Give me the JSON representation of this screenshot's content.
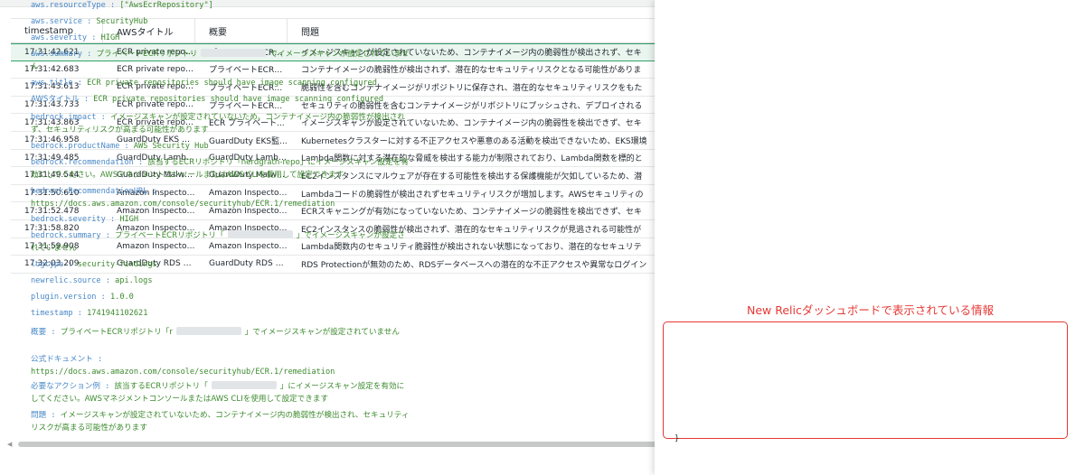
{
  "table": {
    "headers": [
      "timestamp",
      "AWSタイトル",
      "概要",
      "問題"
    ],
    "rows": [
      {
        "timestamp": "17:31:42.621",
        "title": "ECR private reposit...",
        "summary": "プライベートECRリ...",
        "problem": "イメージスキャンが設定されていないため、コンテナイメージ内の脆弱性が検出されず、セキ"
      },
      {
        "timestamp": "17:31:42.683",
        "title": "ECR private reposit...",
        "summary": "プライベートECRリ...",
        "problem": "コンテナイメージの脆弱性が検出されず、潜在的なセキュリティリスクとなる可能性がありま"
      },
      {
        "timestamp": "17:31:43.613",
        "title": "ECR private reposit...",
        "summary": "プライベートECRリ...",
        "problem": "脆弱性を含むコンテナイメージがリポジトリに保存され、潜在的なセキュリティリスクをもた"
      },
      {
        "timestamp": "17:31:43.733",
        "title": "ECR private reposit...",
        "summary": "プライベートECRリ...",
        "problem": "セキュリティの脆弱性を含むコンテナイメージがリポジトリにプッシュされ、デプロイされる"
      },
      {
        "timestamp": "17:31:43.863",
        "title": "ECR private reposit...",
        "summary": "ECR プライベート...",
        "problem": "イメージスキャンが設定されていないため、コンテナイメージ内の脆弱性を検出できず、セキ"
      },
      {
        "timestamp": "17:31:46.958",
        "title": "GuardDuty EKS Au...",
        "summary": "GuardDuty EKS監...",
        "problem": "Kubernetesクラスターに対する不正アクセスや悪意のある活動を検出できないため、EKS環境"
      },
      {
        "timestamp": "17:31:49.485",
        "title": "GuardDuty Lambda...",
        "summary": "GuardDuty Lambda...",
        "problem": "Lambda関数に対する潜在的な脅威を検出する能力が制限されており、Lambda関数を標的と"
      },
      {
        "timestamp": "17:31:49.544",
        "title": "GuardDuty Malwar...",
        "summary": "GuardDuty Malwar...",
        "problem": "EC2インスタンスにマルウェアが存在する可能性を検出する保護機能が欠如しているため、潜"
      },
      {
        "timestamp": "17:31:50.610",
        "title": "Amazon Inspector ...",
        "summary": "Amazon Inspector ...",
        "problem": "Lambdaコードの脆弱性が検出されずセキュリティリスクが増加します。AWSセキュリティの"
      },
      {
        "timestamp": "17:31:52.478",
        "title": "Amazon Inspector ...",
        "summary": "Amazon Inspector ...",
        "problem": "ECRスキャニングが有効になっていないため、コンテナイメージの脆弱性を検出できず、セキ"
      },
      {
        "timestamp": "17:31:58.820",
        "title": "Amazon Inspector ...",
        "summary": "Amazon Inspector ...",
        "problem": "EC2インスタンスの脆弱性が検出されず、潜在的なセキュリティリスクが見逃される可能性が"
      },
      {
        "timestamp": "17:31:59.908",
        "title": "Amazon Inspector ...",
        "summary": "Amazon Inspector ...",
        "problem": "Lambda関数内のセキュリティ脆弱性が検出されない状態になっており、潜在的なセキュリテ"
      },
      {
        "timestamp": "17:32:03.209",
        "title": "GuardDuty RDS Pr...",
        "summary": "GuardDuty RDS Pr...",
        "problem": "RDS Protectionが無効のため、RDSデータベースへの潜在的な不正アクセスや異常なログイン"
      }
    ]
  },
  "detail": {
    "sep": " : ",
    "resource_type": {
      "key": "aws.resourceType",
      "value": "[\"AwsEcrRepository\"]"
    },
    "service": {
      "key": "aws.service",
      "value": "SecurityHub"
    },
    "severity": {
      "key": "aws.severity",
      "value": "HIGH"
    },
    "summary": {
      "key": "aws.summary",
      "value_a": "プライベートECRリポジトリ",
      "value_b": "でイメージスキャンが設定されていません"
    },
    "title": {
      "key": "aws.title",
      "value": "ECR private repositories should have image scanning configured"
    },
    "aws_title_jp": {
      "key": "AWSタイトル",
      "value": "ECR private repositories should have image scanning configured"
    },
    "impact": {
      "key": "bedrock.impact",
      "value": "イメージスキャンが設定されていないため、コンテナイメージ内の脆弱性が検出されず、セキュリティリスクが高まる可能性があります"
    },
    "product_name": {
      "key": "bedrock.productName",
      "value": "AWS Security Hub"
    },
    "recommendation": {
      "key": "bedrock.recommendation",
      "value": "該当するECRリポジトリ「nerdgrath-repo」にイメージスキャン設定を有効にしてください。AWSマネジメントコンソールまたはAWS CLIを使用して設定できます"
    },
    "recommendation_url": {
      "key": "bedrock.RecommendationURL",
      "value": "https://docs.aws.amazon.com/console/securityhub/ECR.1/remediation"
    },
    "b_severity": {
      "key": "bedrock.severity",
      "value": "HIGH"
    },
    "b_summary": {
      "key": "bedrock.summary",
      "value_a": "プライベートECRリポジトリ「",
      "value_b": "」でイメージスキャンが設定されていません"
    },
    "logtype": {
      "key": "logtype",
      "value": "security-findings"
    },
    "nr_source": {
      "key": "newrelic.source",
      "value": "api.logs"
    },
    "plugin_version": {
      "key": "plugin.version",
      "value": "1.0.0"
    },
    "timestamp": {
      "key": "timestamp",
      "value": "1741941102621"
    },
    "nr_caption": "New Relicダッシュボードで表示されている情報",
    "overview": {
      "key": "概要",
      "value_a": "プライベートECRリポジトリ「r",
      "value_b": "」でイメージスキャンが設定されていません"
    },
    "docs": {
      "key": "公式ドキュメント",
      "value": "https://docs.aws.amazon.com/console/securityhub/ECR.1/remediation"
    },
    "action": {
      "key": "必要なアクション例",
      "value_a": "該当するECRリポジトリ「",
      "value_b": "」にイメージスキャン設定を有効にしてください。AWSマネジメントコンソールまたはAWS CLIを使用して設定できます"
    },
    "problem": {
      "key": "問題",
      "value": "イメージスキャンが設定されていないため、コンテナイメージ内の脆弱性が検出され、セキュリティリスクが高まる可能性があります"
    },
    "closing_brace": "}"
  },
  "colors": {
    "key": "#4a89c8",
    "value": "#3c8a2e",
    "callout": "#e53935",
    "selected": "#2fa36a"
  }
}
